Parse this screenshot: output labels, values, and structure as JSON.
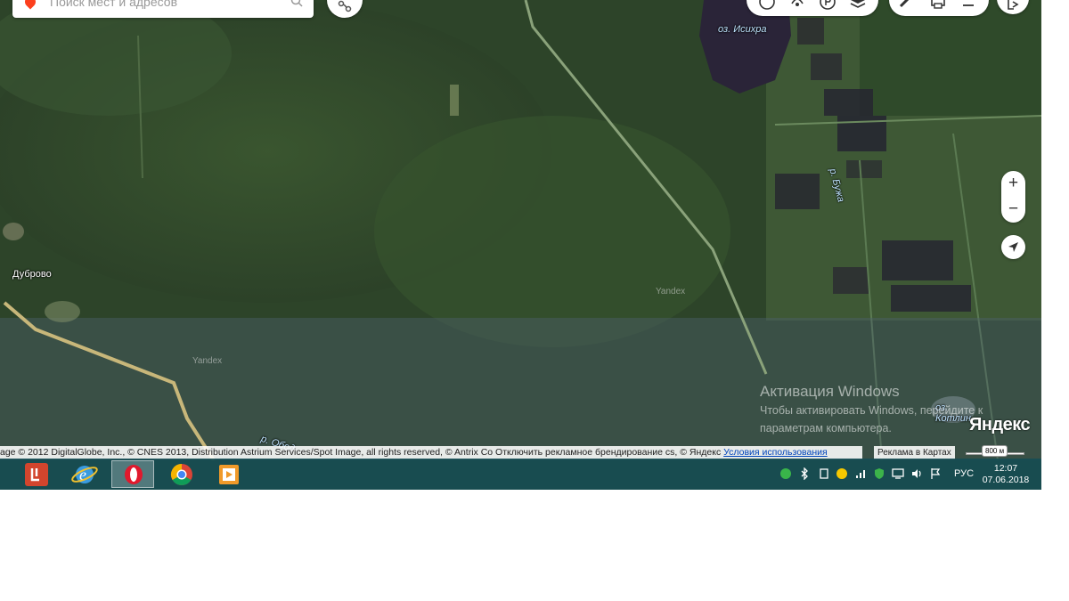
{
  "search": {
    "placeholder": "Поиск мест и адресов"
  },
  "map": {
    "labels": {
      "lake_isikhra": "оз. Исихра",
      "river_buzha": "р. Бужа",
      "village_dubrovo": "Дуброво",
      "river_obod": "р. Обод",
      "lake_kotlin": "оз. Котлин",
      "watermark_1": "Yandex",
      "watermark_2": "Yandex"
    },
    "zoom_in_label": "+",
    "zoom_out_label": "−",
    "logo": "Яндекс",
    "copyright_text": "age © 2012 DigitalGlobe, Inc., © CNES 2013, Distribution Astrium Services/Spot Image, all rights reserved, © Antrix Co",
    "branding_text": "Отключить рекламное брендирование",
    "copyright_tail": "cs, © Яндекс",
    "terms_link": "Условия использования",
    "ad_text": "Реклама в Картах",
    "scale_label": "800 м"
  },
  "activation": {
    "title": "Активация Windows",
    "line1": "Чтобы активировать Windows, перейдите к",
    "line2": "параметрам компьютера."
  },
  "taskbar": {
    "apps": [
      "yandex-browser-icon",
      "internet-explorer-icon",
      "opera-icon",
      "chrome-icon",
      "media-player-icon"
    ],
    "language": "РУС",
    "time": "12:07",
    "date": "07.06.2018"
  }
}
